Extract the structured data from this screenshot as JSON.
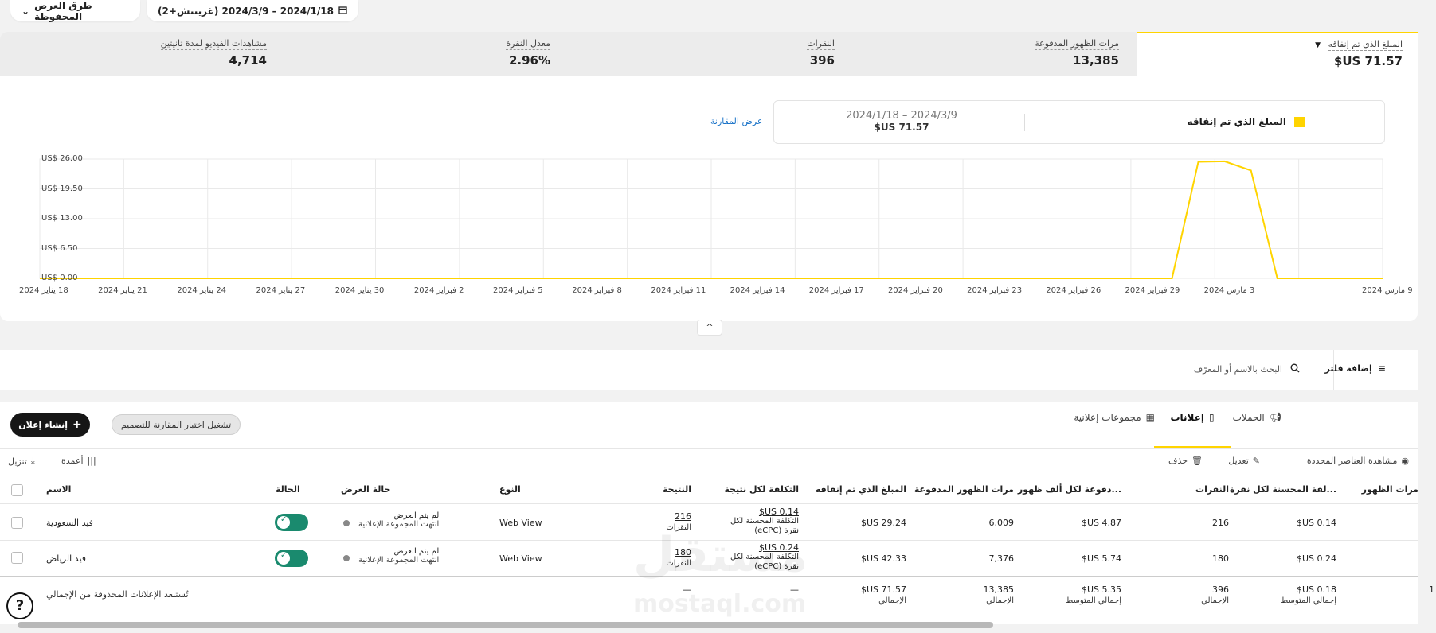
{
  "header": {
    "saved_views_label": "طرق العرض المحفوظة",
    "date_range_label": "2024/1/18 – 2024/3/9 (غرينتش+2)"
  },
  "metrics": {
    "spend": {
      "label": "المبلغ الذي تم إنفاقه",
      "value": "71.57 US$"
    },
    "impressions": {
      "label": "مرات الظهور المدفوعة",
      "value": "13,385"
    },
    "clicks": {
      "label": "النقرات",
      "value": "396"
    },
    "ctr": {
      "label": "معدل النقرة",
      "value": "2.96%"
    },
    "video_views": {
      "label": "مشاهدات الفيديو لمدة ثانيتين",
      "value": "4,714"
    }
  },
  "legend": {
    "series_label": "المبلغ الذي تم إنفاقه",
    "range": "2024/1/18 – 2024/3/9",
    "total": "71.57 US$",
    "compare_link": "عرض المقارنة",
    "color": "#ffd400"
  },
  "chart_data": {
    "type": "line",
    "series_name": "المبلغ الذي تم إنفاقه",
    "y_ticks": [
      "US$ 26.00",
      "US$ 19.50",
      "US$ 13.00",
      "US$ 6.50",
      "US$ 0.00"
    ],
    "ylim": [
      0,
      26
    ],
    "x_ticks": [
      "18 يناير 2024",
      "21 يناير 2024",
      "24 يناير 2024",
      "27 يناير 2024",
      "30 يناير 2024",
      "2 فبراير 2024",
      "5 فبراير 2024",
      "8 فبراير 2024",
      "11 فبراير 2024",
      "14 فبراير 2024",
      "17 فبراير 2024",
      "20 فبراير 2024",
      "23 فبراير 2024",
      "26 فبراير 2024",
      "29 فبراير 2024",
      "3 مارس 2024",
      "9 مارس 2024"
    ],
    "x": [
      "2024-01-18",
      "2024-01-19",
      "2024-01-20",
      "2024-01-21",
      "2024-01-22",
      "2024-01-23",
      "2024-01-24",
      "2024-01-25",
      "2024-01-26",
      "2024-01-27",
      "2024-01-28",
      "2024-01-29",
      "2024-01-30",
      "2024-01-31",
      "2024-02-01",
      "2024-02-02",
      "2024-02-03",
      "2024-02-04",
      "2024-02-05",
      "2024-02-06",
      "2024-02-07",
      "2024-02-08",
      "2024-02-09",
      "2024-02-10",
      "2024-02-11",
      "2024-02-12",
      "2024-02-13",
      "2024-02-14",
      "2024-02-15",
      "2024-02-16",
      "2024-02-17",
      "2024-02-18",
      "2024-02-19",
      "2024-02-20",
      "2024-02-21",
      "2024-02-22",
      "2024-02-23",
      "2024-02-24",
      "2024-02-25",
      "2024-02-26",
      "2024-02-27",
      "2024-02-28",
      "2024-02-29",
      "2024-03-01",
      "2024-03-02",
      "2024-03-03",
      "2024-03-04",
      "2024-03-05",
      "2024-03-06",
      "2024-03-07",
      "2024-03-08",
      "2024-03-09"
    ],
    "values": [
      0,
      0,
      0,
      0,
      0,
      0,
      0,
      0,
      0,
      0,
      0,
      0,
      0,
      0,
      0,
      0,
      0,
      0,
      0,
      0,
      0,
      0,
      0,
      0,
      0,
      0,
      0,
      0,
      0,
      0,
      0,
      0,
      0,
      0,
      0,
      0,
      0,
      0,
      0,
      0,
      0,
      0,
      0,
      0,
      25.4,
      25.5,
      23.5,
      0,
      0,
      0,
      0,
      0
    ],
    "grid": true,
    "color": "#ffd400"
  },
  "filters": {
    "add_filter": "إضافة فلتر",
    "search_placeholder": "البحث بالاسم أو المعرّف"
  },
  "tabs": [
    "الحملات",
    "مجموعات إعلانية",
    "إعلانات"
  ],
  "actions": {
    "create_ad": "إنشاء إعلان",
    "ab_test": "تشغيل اختبار المقارنة للتصميم"
  },
  "toolbar": {
    "view_selected": "مشاهدة العناصر المحددة",
    "edit": "تعديل",
    "delete": "حذف",
    "columns": "أعمدة",
    "download": "تنزيل"
  },
  "columns": {
    "name": "الاسم",
    "status": "الحالة",
    "delivery": "حالة العرض",
    "type": "النوع",
    "result": "النتيجة",
    "cost_per_result": "التكلفة لكل نتيجة",
    "spend": "المبلغ الذي تم إنفاقه",
    "impressions": "مرات الظهور المدفوعة",
    "cpm": "...دفوعة لكل ألف ظهور",
    "clicks": "النقرات",
    "ecpc": "...لفة المحسنة لكل نقرة",
    "views": "مرات الظهور"
  },
  "rows": [
    {
      "name": "فيد السعودية",
      "delivery_main": "لم يتم العرض",
      "delivery_sub": "انتهت المجموعة الإعلانية",
      "type": "Web View",
      "result": "216",
      "result_label": "النقرات",
      "cpr": "0.14 US$",
      "cpr_label": "التكلفة المحسنة لكل نقرة (eCPC)",
      "spend": "29.24 US$",
      "impressions": "6,009",
      "cpm": "4.87 US$",
      "clicks": "216",
      "ecpc": "0.14 US$"
    },
    {
      "name": "فيد الرياض",
      "delivery_main": "لم يتم العرض",
      "delivery_sub": "انتهت المجموعة الإعلانية",
      "type": "Web View",
      "result": "180",
      "result_label": "النقرات",
      "cpr": "0.24 US$",
      "cpr_label": "التكلفة المحسنة لكل نقرة (eCPC)",
      "spend": "42.33 US$",
      "impressions": "7,376",
      "cpm": "5.74 US$",
      "clicks": "180",
      "ecpc": "0.24 US$"
    }
  ],
  "totals": {
    "note": "تُستبعد الإعلانات المحذوفة من الإجمالي",
    "result": "—",
    "cpr": "—",
    "spend": "71.57 US$",
    "spend_label": "الإجمالي",
    "impressions": "13,385",
    "impressions_label": "الإجمالي",
    "cpm": "5.35 US$",
    "cpm_label": "إجمالي المتوسط",
    "clicks": "396",
    "clicks_label": "الإجمالي",
    "ecpc": "0.18 US$",
    "ecpc_label": "إجمالي المتوسط",
    "views": "1"
  },
  "watermark": {
    "arabic": "مستقل",
    "latin": "mostaql.com"
  }
}
